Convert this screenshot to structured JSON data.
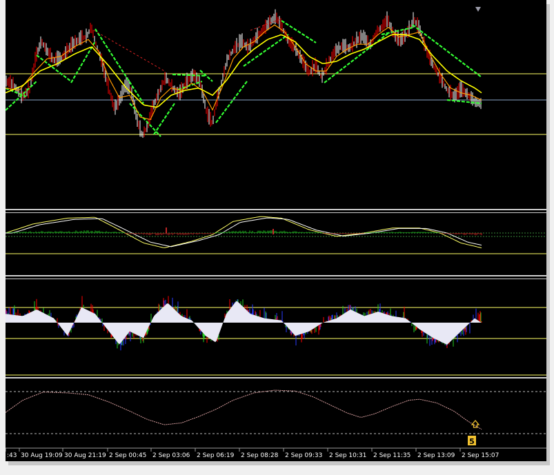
{
  "app": {
    "title": ""
  },
  "colors": {
    "background": "#000000",
    "frame": "#f0f0f0",
    "candle_up": "#ffffff",
    "candle_down": "#ff0000",
    "ma_fast": "#ff9900",
    "ma_slow": "#ffff00",
    "trend_line": "#33ff33",
    "level_line": "#ffff66",
    "price_line": "#8aa6c8",
    "osc_pos": "#ffffff",
    "osc_red": "#ff0000",
    "osc_blue": "#2a3cff",
    "osc_green": "#22cc22",
    "osc_fill": "#e8e8f5",
    "cycle_line": "#d9a0a0"
  },
  "icons": {
    "scroll_marker": "triangle-down-icon",
    "signal_arrow": "arrow-up-icon"
  },
  "signal_label": "5",
  "chart_data": {
    "type": "line",
    "x_axis_labels": [
      ":43",
      "30 Aug 19:09",
      "30 Aug 21:19",
      "2 Sep 00:45",
      "2 Sep 03:06",
      "2 Sep 06:19",
      "2 Sep 08:28",
      "2 Sep 09:33",
      "2 Sep 10:31",
      "2 Sep 11:35",
      "2 Sep 13:09",
      "2 Sep 15:07"
    ],
    "main_price_trace": [
      [
        0,
        0.55
      ],
      [
        12,
        0.58
      ],
      [
        24,
        0.68
      ],
      [
        35,
        0.62
      ],
      [
        44,
        0.35
      ],
      [
        52,
        0.22
      ],
      [
        60,
        0.3
      ],
      [
        70,
        0.38
      ],
      [
        82,
        0.36
      ],
      [
        95,
        0.26
      ],
      [
        108,
        0.2
      ],
      [
        118,
        0.18
      ],
      [
        124,
        0.1
      ],
      [
        130,
        0.22
      ],
      [
        140,
        0.4
      ],
      [
        150,
        0.62
      ],
      [
        158,
        0.78
      ],
      [
        166,
        0.7
      ],
      [
        174,
        0.58
      ],
      [
        182,
        0.62
      ],
      [
        190,
        0.86
      ],
      [
        198,
        1.0
      ],
      [
        206,
        0.92
      ],
      [
        214,
        0.76
      ],
      [
        222,
        0.65
      ],
      [
        232,
        0.52
      ],
      [
        242,
        0.6
      ],
      [
        252,
        0.66
      ],
      [
        262,
        0.56
      ],
      [
        272,
        0.5
      ],
      [
        282,
        0.56
      ],
      [
        292,
        0.82
      ],
      [
        300,
        0.9
      ],
      [
        306,
        0.72
      ],
      [
        314,
        0.54
      ],
      [
        322,
        0.36
      ],
      [
        332,
        0.28
      ],
      [
        342,
        0.22
      ],
      [
        352,
        0.28
      ],
      [
        362,
        0.2
      ],
      [
        372,
        0.14
      ],
      [
        384,
        0.06
      ],
      [
        392,
        0.02
      ],
      [
        402,
        0.12
      ],
      [
        410,
        0.22
      ],
      [
        420,
        0.28
      ],
      [
        430,
        0.38
      ],
      [
        440,
        0.48
      ],
      [
        450,
        0.42
      ],
      [
        458,
        0.52
      ],
      [
        468,
        0.4
      ],
      [
        478,
        0.3
      ],
      [
        488,
        0.26
      ],
      [
        498,
        0.28
      ],
      [
        508,
        0.22
      ],
      [
        518,
        0.18
      ],
      [
        528,
        0.26
      ],
      [
        538,
        0.14
      ],
      [
        546,
        0.1
      ],
      [
        554,
        0.04
      ],
      [
        562,
        0.16
      ],
      [
        572,
        0.22
      ],
      [
        582,
        0.16
      ],
      [
        592,
        0.04
      ],
      [
        600,
        0.12
      ],
      [
        610,
        0.3
      ],
      [
        620,
        0.42
      ],
      [
        630,
        0.52
      ],
      [
        640,
        0.62
      ],
      [
        650,
        0.68
      ],
      [
        660,
        0.62
      ],
      [
        670,
        0.66
      ],
      [
        680,
        0.72
      ],
      [
        690,
        0.74
      ]
    ],
    "main_ma_fast": [
      [
        0,
        0.6
      ],
      [
        20,
        0.62
      ],
      [
        40,
        0.48
      ],
      [
        60,
        0.36
      ],
      [
        80,
        0.34
      ],
      [
        100,
        0.26
      ],
      [
        120,
        0.2
      ],
      [
        135,
        0.3
      ],
      [
        150,
        0.52
      ],
      [
        165,
        0.68
      ],
      [
        180,
        0.66
      ],
      [
        195,
        0.84
      ],
      [
        210,
        0.86
      ],
      [
        225,
        0.68
      ],
      [
        240,
        0.6
      ],
      [
        255,
        0.62
      ],
      [
        270,
        0.56
      ],
      [
        285,
        0.62
      ],
      [
        300,
        0.78
      ],
      [
        315,
        0.58
      ],
      [
        330,
        0.36
      ],
      [
        345,
        0.26
      ],
      [
        360,
        0.22
      ],
      [
        375,
        0.14
      ],
      [
        390,
        0.08
      ],
      [
        405,
        0.14
      ],
      [
        420,
        0.26
      ],
      [
        435,
        0.4
      ],
      [
        450,
        0.46
      ],
      [
        465,
        0.46
      ],
      [
        480,
        0.34
      ],
      [
        495,
        0.28
      ],
      [
        510,
        0.24
      ],
      [
        525,
        0.24
      ],
      [
        540,
        0.16
      ],
      [
        555,
        0.1
      ],
      [
        570,
        0.18
      ],
      [
        585,
        0.16
      ],
      [
        600,
        0.14
      ],
      [
        615,
        0.32
      ],
      [
        630,
        0.48
      ],
      [
        645,
        0.6
      ],
      [
        660,
        0.64
      ],
      [
        675,
        0.66
      ],
      [
        690,
        0.7
      ]
    ],
    "main_ma_slow": [
      [
        0,
        0.64
      ],
      [
        25,
        0.58
      ],
      [
        50,
        0.46
      ],
      [
        75,
        0.4
      ],
      [
        100,
        0.32
      ],
      [
        125,
        0.26
      ],
      [
        150,
        0.42
      ],
      [
        175,
        0.6
      ],
      [
        200,
        0.74
      ],
      [
        220,
        0.76
      ],
      [
        240,
        0.66
      ],
      [
        260,
        0.62
      ],
      [
        280,
        0.6
      ],
      [
        300,
        0.66
      ],
      [
        320,
        0.54
      ],
      [
        340,
        0.38
      ],
      [
        360,
        0.28
      ],
      [
        380,
        0.2
      ],
      [
        400,
        0.16
      ],
      [
        420,
        0.22
      ],
      [
        440,
        0.34
      ],
      [
        460,
        0.4
      ],
      [
        480,
        0.38
      ],
      [
        500,
        0.32
      ],
      [
        520,
        0.28
      ],
      [
        540,
        0.22
      ],
      [
        560,
        0.16
      ],
      [
        580,
        0.16
      ],
      [
        600,
        0.2
      ],
      [
        620,
        0.34
      ],
      [
        640,
        0.46
      ],
      [
        660,
        0.54
      ],
      [
        680,
        0.6
      ],
      [
        690,
        0.64
      ]
    ],
    "cycle_trace": [
      [
        0,
        0.55
      ],
      [
        25,
        0.28
      ],
      [
        55,
        0.1
      ],
      [
        90,
        0.12
      ],
      [
        120,
        0.16
      ],
      [
        150,
        0.32
      ],
      [
        180,
        0.52
      ],
      [
        205,
        0.7
      ],
      [
        230,
        0.82
      ],
      [
        255,
        0.78
      ],
      [
        280,
        0.64
      ],
      [
        305,
        0.48
      ],
      [
        330,
        0.28
      ],
      [
        360,
        0.12
      ],
      [
        390,
        0.06
      ],
      [
        420,
        0.08
      ],
      [
        445,
        0.2
      ],
      [
        470,
        0.38
      ],
      [
        495,
        0.56
      ],
      [
        515,
        0.66
      ],
      [
        535,
        0.58
      ],
      [
        560,
        0.42
      ],
      [
        585,
        0.28
      ],
      [
        600,
        0.26
      ],
      [
        625,
        0.34
      ],
      [
        650,
        0.52
      ],
      [
        670,
        0.74
      ],
      [
        690,
        0.92
      ]
    ]
  }
}
